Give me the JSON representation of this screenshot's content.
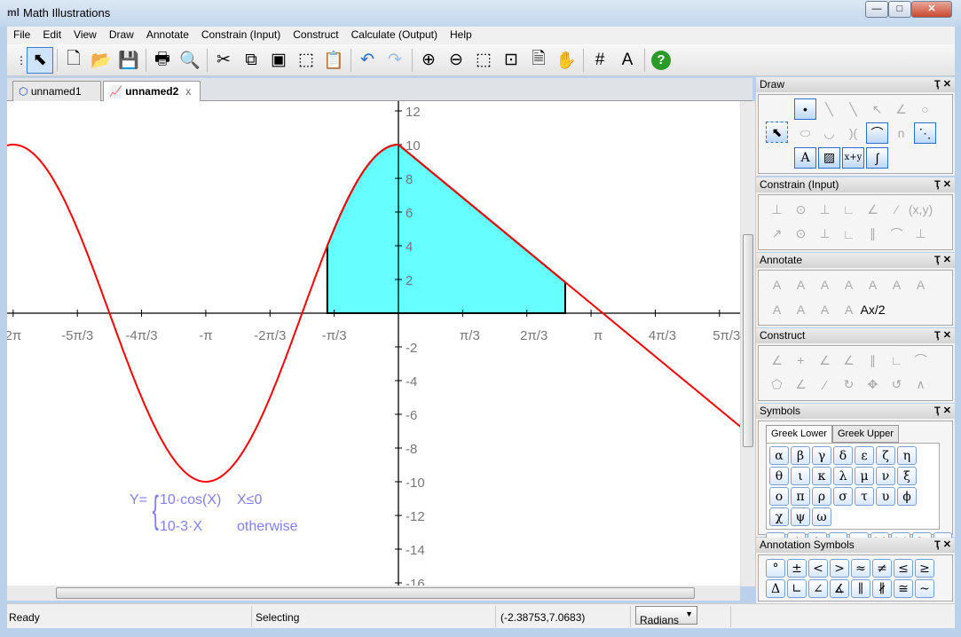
{
  "window": {
    "title": "Math Illustrations",
    "logo": "ml",
    "min": "—",
    "max": "□",
    "close": "✕"
  },
  "menu": [
    "File",
    "Edit",
    "View",
    "Draw",
    "Annotate",
    "Constrain (Input)",
    "Construct",
    "Calculate (Output)",
    "Help"
  ],
  "toolbar": [
    {
      "name": "select-icon",
      "g": "⬉",
      "sel": true
    },
    "sep",
    {
      "name": "new-file-icon",
      "g": "🗋"
    },
    {
      "name": "open-folder-icon",
      "g": "📂"
    },
    {
      "name": "save-icon",
      "g": "💾"
    },
    "sep",
    {
      "name": "print-icon",
      "g": "🖶"
    },
    {
      "name": "print-preview-icon",
      "g": "🔍"
    },
    "sep",
    {
      "name": "cut-icon",
      "g": "✂"
    },
    {
      "name": "copy-icon",
      "g": "⧉"
    },
    {
      "name": "copy-window-icon",
      "g": "▣"
    },
    {
      "name": "copy-selection-icon",
      "g": "⬚"
    },
    {
      "name": "paste-icon",
      "g": "📋"
    },
    "sep",
    {
      "name": "undo-icon",
      "g": "↶"
    },
    {
      "name": "redo-icon",
      "g": "↷"
    },
    "sep",
    {
      "name": "zoom-in-icon",
      "g": "⊕"
    },
    {
      "name": "zoom-out-icon",
      "g": "⊖"
    },
    {
      "name": "zoom-selection-icon",
      "g": "⬚"
    },
    {
      "name": "zoom-fit-icon",
      "g": "⊡"
    },
    {
      "name": "zoom-page-icon",
      "g": "🗎"
    },
    {
      "name": "pan-hand-icon",
      "g": "✋"
    },
    "sep",
    {
      "name": "grid-icon",
      "g": "#"
    },
    {
      "name": "lock-font-icon",
      "g": "A"
    },
    "sep",
    {
      "name": "help-icon",
      "g": "?"
    }
  ],
  "tabs": [
    {
      "label": "unnamed1",
      "active": false
    },
    {
      "label": "unnamed2",
      "active": true,
      "close": "x"
    }
  ],
  "graph": {
    "function": "piecewise",
    "expression_label": "Y=",
    "cases": [
      {
        "expr": "10·cos(X)",
        "cond": "X≤0"
      },
      {
        "expr": "10-3·X",
        "cond": "otherwise"
      }
    ],
    "x_ticks": [
      "2π",
      "-5π/3",
      "-4π/3",
      "-π",
      "-2π/3",
      "-π/3",
      "π/3",
      "2π/3",
      "π",
      "4π/3",
      "5π/3"
    ],
    "x_tick_values": [
      -6.2832,
      -5.236,
      -4.1888,
      -3.1416,
      -2.0944,
      -1.0472,
      1.0472,
      2.0944,
      3.1416,
      4.1888,
      5.236
    ],
    "y_ticks": [
      "12",
      "10",
      "8",
      "6",
      "4",
      "2",
      "-2",
      "-4",
      "-6",
      "-8",
      "-10",
      "-12",
      "-14",
      "-16"
    ],
    "y_tick_values": [
      12,
      10,
      8,
      6,
      4,
      2,
      -2,
      -4,
      -6,
      -8,
      -10,
      -12,
      -14,
      -16
    ],
    "shaded_interval": [
      -1.16,
      2.72
    ],
    "curve_color": "#ff0000",
    "fill_color": "#66ffff",
    "formula_color": "#8080f0"
  },
  "status": {
    "left": "Ready",
    "mode": "Selecting",
    "coords": "(-2.38753,7.0683)",
    "angle_unit": "Radians"
  },
  "panels": {
    "draw": {
      "title": "Draw",
      "items": [
        [
          "point",
          "•",
          1
        ],
        [
          "line",
          "╲",
          0
        ],
        [
          "segment",
          "╲",
          0
        ],
        [
          "ray",
          "↖",
          0
        ],
        [
          "angle",
          "∠",
          0
        ],
        [
          "circle",
          "○",
          0
        ],
        [
          "ellipse",
          "⬭",
          0
        ],
        [
          "parabola",
          "◡",
          0
        ],
        [
          "hyperbola",
          ")(",
          0
        ],
        [
          "curve",
          "⌒",
          1
        ],
        [
          "polygon-n",
          "n",
          0
        ],
        [
          "polyline",
          "⋱",
          1
        ],
        [
          "text",
          "A",
          1
        ],
        [
          "image",
          "▨",
          1
        ],
        [
          "equation",
          "x+y",
          1
        ],
        [
          "function-graph",
          "∫",
          1
        ]
      ]
    },
    "constrain": {
      "title": "Constrain (Input)",
      "glyphs": [
        "⊥",
        "⊙",
        "⊥",
        "∟",
        "∠",
        "∕",
        "(x,y)",
        "↗",
        "⊙",
        "⊥",
        "∟",
        "∥",
        "⌒",
        "⊥"
      ]
    },
    "annotate": {
      "title": "Annotate",
      "glyphs": [
        "A",
        "A",
        "A",
        "A",
        "A",
        "A",
        "A",
        "A",
        "A",
        "A",
        "A",
        "Ax/2"
      ]
    },
    "construct": {
      "title": "Construct",
      "glyphs": [
        "∠",
        "+",
        "∠",
        "∠",
        "∥",
        "∟",
        "⌒",
        "⬠",
        "∠",
        "∕",
        "↻",
        "✥",
        "↺",
        "∧"
      ]
    },
    "symbols": {
      "title": "Symbols",
      "tabs": [
        "Greek Lower",
        "Greek Upper"
      ],
      "greek": [
        "α",
        "β",
        "γ",
        "δ",
        "ε",
        "ζ",
        "η",
        "θ",
        "ι",
        "κ",
        "λ",
        "μ",
        "ν",
        "ξ",
        "ο",
        "π",
        "ρ",
        "σ",
        "τ",
        "υ",
        "ϕ",
        "χ",
        "ψ",
        "ω"
      ],
      "templates": [
        "·",
        "▫/▫",
        "√▫",
        "▪▫",
        "▪▫",
        "(▫)",
        "|▫|",
        "{▫",
        "π"
      ]
    },
    "annotation_symbols": {
      "title": "Annotation Symbols",
      "glyphs": [
        "°",
        "±",
        "<",
        ">",
        "≈",
        "≠",
        "≤",
        "≥",
        "Δ",
        "∟",
        "∠",
        "∡",
        "∥",
        "∦",
        "≅",
        "~"
      ]
    },
    "pin": "📌",
    "close": "✕"
  }
}
